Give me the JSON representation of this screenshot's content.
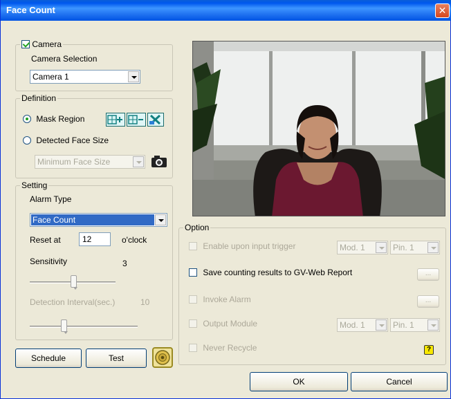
{
  "window": {
    "title": "Face Count",
    "close_glyph": "✕"
  },
  "camera": {
    "checkbox_label": "Camera",
    "checked": true,
    "selection_label": "Camera Selection",
    "selected": "Camera 1"
  },
  "definition": {
    "legend": "Definition",
    "mask_region_label": "Mask Region",
    "detected_face_size_label": "Detected Face Size",
    "face_size_placeholder": "Minimum Face Size",
    "selected_option": "Mask Region"
  },
  "setting": {
    "legend": "Setting",
    "alarm_type_label": "Alarm Type",
    "alarm_type_value": "Face Count",
    "reset_at_label": "Reset at",
    "reset_at_value": "12",
    "reset_suffix": "o'clock",
    "sensitivity_label": "Sensitivity",
    "sensitivity_value": "3",
    "detection_interval_label": "Detection Interval(sec.)",
    "detection_interval_value": "10"
  },
  "option": {
    "legend": "Option",
    "enable_input_trigger_label": "Enable upon input trigger",
    "save_counting_label": "Save counting results to GV-Web Report",
    "invoke_alarm_label": "Invoke Alarm",
    "output_module_label": "Output Module",
    "never_recycle_label": "Never Recycle",
    "mod_value": "Mod. 1",
    "pin_value": "Pin. 1",
    "ellipsis": "..."
  },
  "buttons": {
    "schedule": "Schedule",
    "test": "Test",
    "ok": "OK",
    "cancel": "Cancel"
  },
  "icons": {
    "add_mask": "mask-add-icon",
    "remove_mask": "mask-remove-icon",
    "clear_mask": "mask-clear-icon",
    "snapshot": "camera-icon",
    "audio": "speaker-icon",
    "help": "help-icon"
  },
  "colors": {
    "title_bar": "#0058ee",
    "dialog_bg": "#ece9d8",
    "selection": "#316ac5"
  }
}
